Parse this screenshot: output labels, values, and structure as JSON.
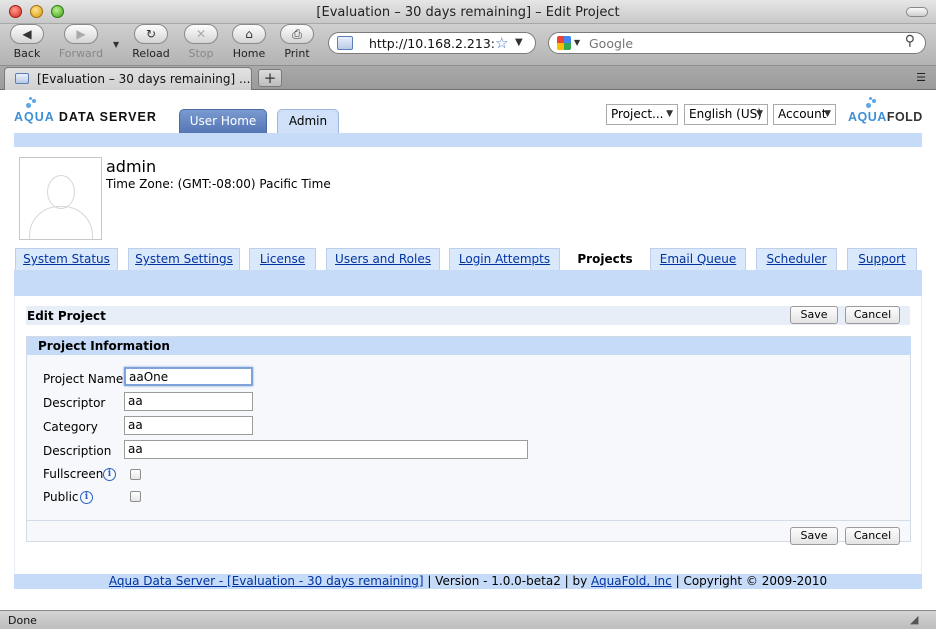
{
  "window": {
    "title": "[Evaluation – 30 days remaining] – Edit Project"
  },
  "toolbar": {
    "back": "Back",
    "forward": "Forward",
    "reload": "Reload",
    "stop": "Stop",
    "home": "Home",
    "print": "Print",
    "url": "http://10.168.2.213:",
    "search_placeholder": "Google"
  },
  "tabs": {
    "active_label": "[Evaluation – 30 days remaining] ...",
    "new_tab": "+"
  },
  "header": {
    "logo_left_aqua": "AQUA",
    "logo_left_rest": " DATA SERVER",
    "tab_user_home": "User Home",
    "tab_admin": "Admin",
    "project_select": "Project...",
    "language_select": "English (US)",
    "account_select": "Account",
    "logo_right_aqua": "AQUA",
    "logo_right_fold": "FOLD"
  },
  "user": {
    "name": "admin",
    "timezone": "Time Zone: (GMT:-08:00) Pacific Time"
  },
  "admin_tabs": [
    "System Status",
    "System Settings",
    "License",
    "Users and Roles",
    "Login Attempts",
    "Projects",
    "Email Queue",
    "Scheduler",
    "Support"
  ],
  "active_admin_tab": "Projects",
  "edit": {
    "title": "Edit Project",
    "save": "Save",
    "cancel": "Cancel",
    "section_title": "Project Information",
    "fields": {
      "project_name_label": "Project Name",
      "project_name_value": "aaOne",
      "descriptor_label": "Descriptor",
      "descriptor_value": "aa",
      "category_label": "Category",
      "category_value": "aa",
      "description_label": "Description",
      "description_value": "aa",
      "fullscreen_label": "Fullscreen",
      "fullscreen_checked": false,
      "public_label": "Public",
      "public_checked": false
    }
  },
  "footer": {
    "product_link": "Aqua Data Server - [Evaluation - 30 days remaining]",
    "version": "| Version - 1.0.0-beta2 | by",
    "company_link": "AquaFold, Inc",
    "copyright": "| Copyright © 2009-2010"
  },
  "status": {
    "text": "Done"
  },
  "colors": {
    "accent_band": "#c6dbf7",
    "tab_user_home": "#6a88c3",
    "link": "#00339f"
  }
}
